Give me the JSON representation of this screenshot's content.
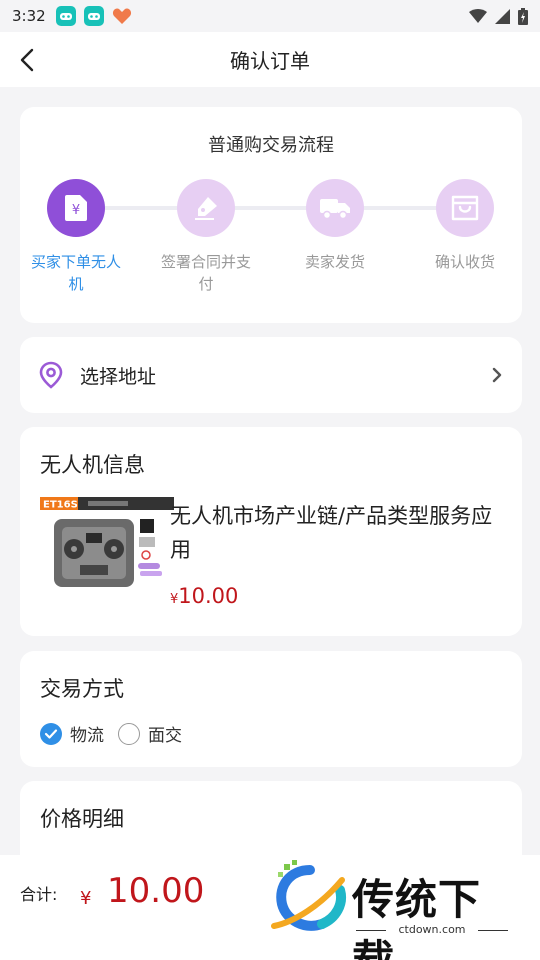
{
  "status_bar": {
    "time": "3:32"
  },
  "nav": {
    "title": "确认订单"
  },
  "flow": {
    "title": "普通购交易流程",
    "steps": [
      {
        "label": "买家下单无人机",
        "icon": "yen-document-icon",
        "state": "active"
      },
      {
        "label": "签署合同并支付",
        "icon": "signature-pen-icon",
        "state": "inactive"
      },
      {
        "label": "卖家发货",
        "icon": "truck-icon",
        "state": "inactive"
      },
      {
        "label": "确认收货",
        "icon": "shopping-bag-icon",
        "state": "inactive"
      }
    ]
  },
  "address": {
    "label": "选择地址"
  },
  "drone_info": {
    "title": "无人机信息",
    "product": {
      "image_text": "ET16S",
      "name": "无人机市场产业链/产品类型服务应用",
      "price_symbol": "¥",
      "price": "10.00"
    }
  },
  "trade": {
    "title": "交易方式",
    "options": [
      {
        "label": "物流",
        "checked": true
      },
      {
        "label": "面交",
        "checked": false
      }
    ]
  },
  "price_detail": {
    "title": "价格明细"
  },
  "footer": {
    "total_label": "合计:",
    "currency": "¥",
    "total": "10.00"
  },
  "watermark": {
    "text": "传统下载",
    "sub": "ctdown.com"
  },
  "colors": {
    "accent_purple": "#8f4fd8",
    "light_purple": "#e7cff3",
    "blue": "#2f8fe6",
    "price_red": "#c0161b"
  }
}
